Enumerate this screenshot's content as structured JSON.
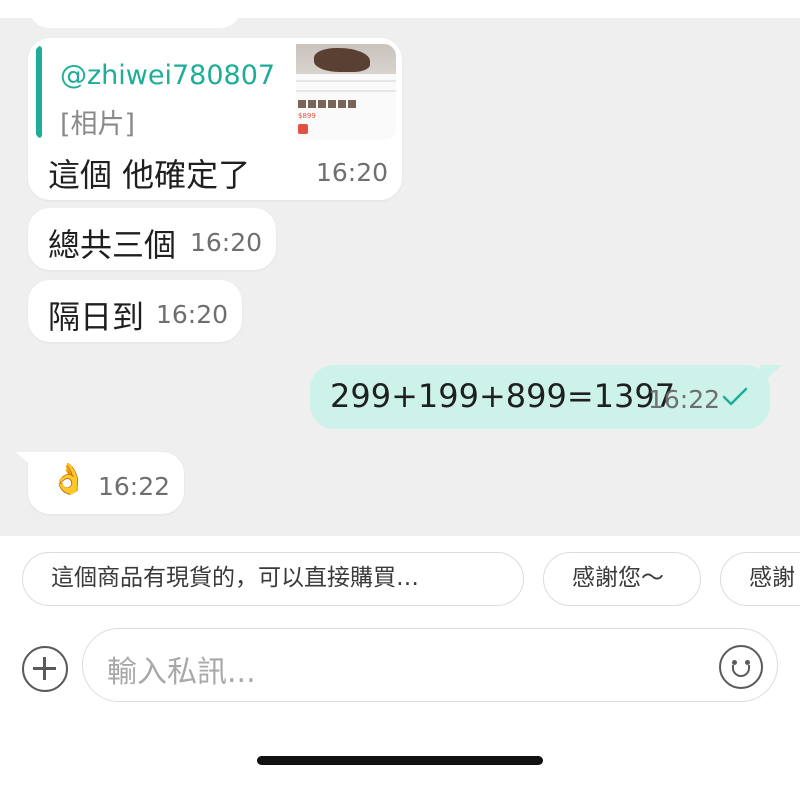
{
  "messages": {
    "reply": {
      "quote_user": "@zhiwei780807",
      "quote_kind": "[相片]",
      "text": "這個 他確定了",
      "time": "16:20"
    },
    "incoming": [
      {
        "text": "總共三個",
        "time": "16:20"
      },
      {
        "text": "隔日到",
        "time": "16:20"
      }
    ],
    "outgoing": {
      "text": "299+199+899=1397",
      "time": "16:22",
      "status_icon": "check-icon"
    },
    "reaction": {
      "text": "👌",
      "time": "16:22"
    }
  },
  "thumbnail": {
    "price": "$899"
  },
  "quick_replies": [
    "這個商品有現貨的，可以直接購買…",
    "感謝您～",
    "感謝"
  ],
  "composer": {
    "placeholder": "輸入私訊...",
    "add_icon": "plus-circle-icon",
    "emoji_icon": "smiley-icon"
  },
  "colors": {
    "accent": "#1eae98",
    "outgoing_bubble": "#cdf2ea",
    "chat_background": "#efefef"
  }
}
